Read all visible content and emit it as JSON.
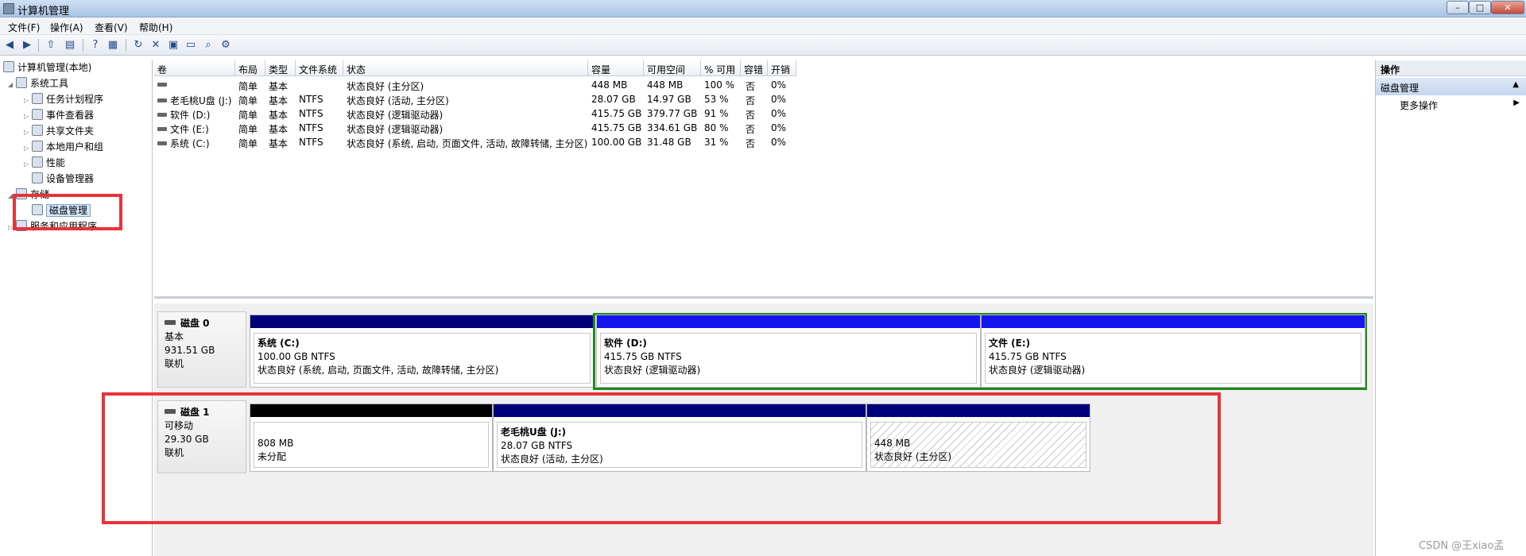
{
  "window": {
    "title": "计算机管理",
    "min": "–",
    "max": "□",
    "close": "✕"
  },
  "menu": [
    "文件(F)",
    "操作(A)",
    "查看(V)",
    "帮助(H)"
  ],
  "toolbar_icons": [
    "back-icon",
    "forward-icon",
    "up-folder-icon",
    "show-hide-tree-icon",
    "help-icon",
    "properties-icon",
    "refresh-icon",
    "delete-icon",
    "properties-sheet-icon",
    "open-icon",
    "search-icon",
    "settings-icon"
  ],
  "tree": {
    "root": "计算机管理(本地)",
    "system_tools": "系统工具",
    "task_scheduler": "任务计划程序",
    "event_viewer": "事件查看器",
    "shared_folders": "共享文件夹",
    "local_users": "本地用户和组",
    "performance": "性能",
    "device_manager": "设备管理器",
    "storage": "存储",
    "disk_management": "磁盘管理",
    "services_apps": "服务和应用程序"
  },
  "actions": {
    "header": "操作",
    "section": "磁盘管理",
    "more": "更多操作"
  },
  "columns": [
    "卷",
    "布局",
    "类型",
    "文件系统",
    "状态",
    "容量",
    "可用空间",
    "% 可用",
    "容错",
    "开销"
  ],
  "volumes": [
    {
      "name": "",
      "layout": "简单",
      "type": "基本",
      "fs": "",
      "status": "状态良好 (主分区)",
      "capacity": "448 MB",
      "free": "448 MB",
      "pct": "100 %",
      "ft": "否",
      "overhead": "0%"
    },
    {
      "name": "老毛桃U盘 (J:)",
      "layout": "简单",
      "type": "基本",
      "fs": "NTFS",
      "status": "状态良好 (活动, 主分区)",
      "capacity": "28.07 GB",
      "free": "14.97 GB",
      "pct": "53 %",
      "ft": "否",
      "overhead": "0%"
    },
    {
      "name": "软件 (D:)",
      "layout": "简单",
      "type": "基本",
      "fs": "NTFS",
      "status": "状态良好 (逻辑驱动器)",
      "capacity": "415.75 GB",
      "free": "379.77 GB",
      "pct": "91 %",
      "ft": "否",
      "overhead": "0%"
    },
    {
      "name": "文件 (E:)",
      "layout": "简单",
      "type": "基本",
      "fs": "NTFS",
      "status": "状态良好 (逻辑驱动器)",
      "capacity": "415.75 GB",
      "free": "334.61 GB",
      "pct": "80 %",
      "ft": "否",
      "overhead": "0%"
    },
    {
      "name": "系统 (C:)",
      "layout": "简单",
      "type": "基本",
      "fs": "NTFS",
      "status": "状态良好 (系统, 启动, 页面文件, 活动, 故障转储, 主分区)",
      "capacity": "100.00 GB",
      "free": "31.48 GB",
      "pct": "31 %",
      "ft": "否",
      "overhead": "0%"
    }
  ],
  "disk0": {
    "name": "磁盘 0",
    "type": "基本",
    "size": "931.51 GB",
    "state": "联机",
    "partitions": [
      {
        "name": "系统 (C:)",
        "size": "100.00 GB NTFS",
        "status": "状态良好 (系统, 启动, 页面文件, 活动, 故障转储, 主分区)",
        "bar": "#00007a"
      },
      {
        "name": "软件 (D:)",
        "size": "415.75 GB NTFS",
        "status": "状态良好 (逻辑驱动器)",
        "bar": "#1515f0"
      },
      {
        "name": "文件 (E:)",
        "size": "415.75 GB NTFS",
        "status": "状态良好 (逻辑驱动器)",
        "bar": "#1515f0"
      }
    ],
    "extended_border": "#1f8a1f"
  },
  "disk1": {
    "name": "磁盘 1",
    "type": "可移动",
    "size": "29.30 GB",
    "state": "联机",
    "partitions": [
      {
        "name": "",
        "size": "808 MB",
        "status": "未分配",
        "bar": "#000000"
      },
      {
        "name": "老毛桃U盘 (J:)",
        "size": "28.07 GB NTFS",
        "status": "状态良好 (活动, 主分区)",
        "bar": "#00007a"
      },
      {
        "name": "",
        "size": "448 MB",
        "status": "状态良好 (主分区)",
        "bar": "#00007a"
      }
    ]
  },
  "highlight_color": "#e8333a",
  "watermark": "CSDN @王xiao孟"
}
